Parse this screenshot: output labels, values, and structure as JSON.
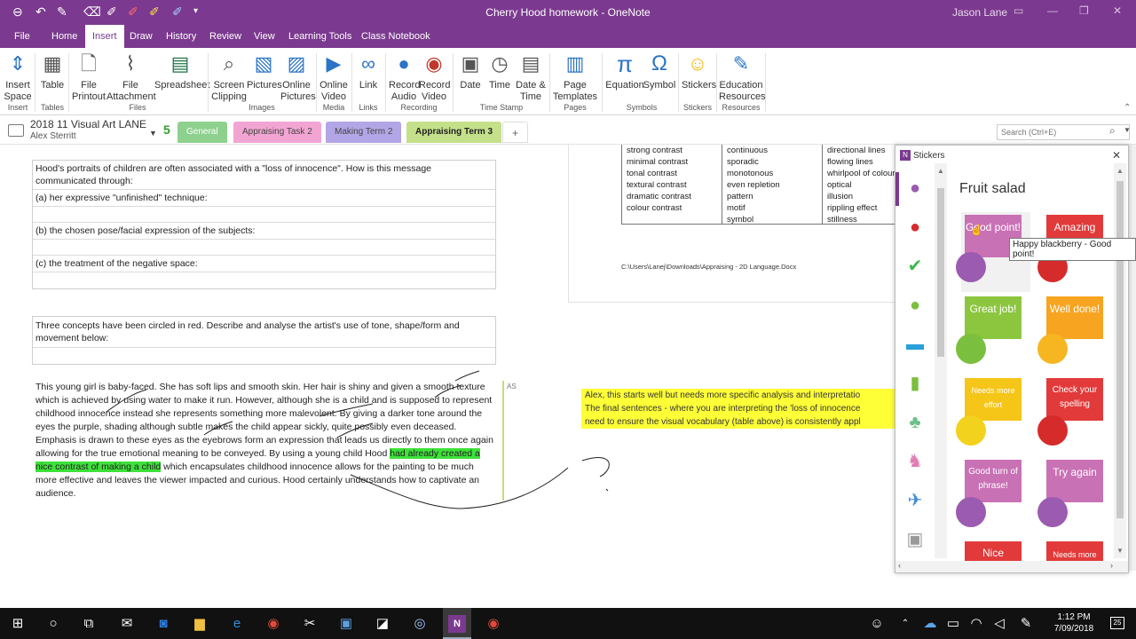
{
  "window": {
    "title": "Cherry Hood homework - OneNote",
    "user": "Jason Lane"
  },
  "menu": [
    "File",
    "Home",
    "Insert",
    "Draw",
    "History",
    "Review",
    "View",
    "Learning Tools",
    "Class Notebook"
  ],
  "ribbon": {
    "buttons": [
      {
        "id": "insert-space",
        "label": "Insert\nSpace",
        "icon": "arrow-up-down-icon"
      },
      {
        "id": "table",
        "label": "Table",
        "icon": "table-icon"
      },
      {
        "id": "file-printout",
        "label": "File\nPrintout",
        "icon": "file-icon"
      },
      {
        "id": "file-attachment",
        "label": "File\nAttachment",
        "icon": "paperclip-icon"
      },
      {
        "id": "spreadsheet",
        "label": "Spreadsheet",
        "icon": "excel-icon"
      },
      {
        "id": "screen-clipping",
        "label": "Screen\nClipping",
        "icon": "camera-icon"
      },
      {
        "id": "pictures",
        "label": "Pictures",
        "icon": "picture-icon"
      },
      {
        "id": "online-pictures",
        "label": "Online\nPictures",
        "icon": "online-picture-icon"
      },
      {
        "id": "online-video",
        "label": "Online\nVideo",
        "icon": "video-icon"
      },
      {
        "id": "link",
        "label": "Link",
        "icon": "link-icon"
      },
      {
        "id": "record-audio",
        "label": "Record\nAudio",
        "icon": "microphone-icon"
      },
      {
        "id": "record-video",
        "label": "Record\nVideo",
        "icon": "camera-record-icon"
      },
      {
        "id": "date",
        "label": "Date",
        "icon": "calendar-icon"
      },
      {
        "id": "time",
        "label": "Time",
        "icon": "clock-icon"
      },
      {
        "id": "date-time",
        "label": "Date &\nTime",
        "icon": "calendar-clock-icon"
      },
      {
        "id": "page-templates",
        "label": "Page\nTemplates",
        "icon": "page-icon"
      },
      {
        "id": "equation",
        "label": "Equation",
        "icon": "pi-icon"
      },
      {
        "id": "symbol",
        "label": "Symbol",
        "icon": "omega-icon"
      },
      {
        "id": "stickers",
        "label": "Stickers",
        "icon": "smiley-icon"
      },
      {
        "id": "education-resources",
        "label": "Education\nResources",
        "icon": "education-icon"
      }
    ],
    "groups": [
      "Insert",
      "Tables",
      "Files",
      "Images",
      "Media",
      "Links",
      "Recording",
      "Time Stamp",
      "Pages",
      "Symbols",
      "Stickers",
      "Resources"
    ]
  },
  "notebook": {
    "name": "2018 11 Visual Art LANE",
    "owner": "Alex Sterritt",
    "tab_count": "5"
  },
  "sections": [
    {
      "label": "General",
      "color": "#8ed18e"
    },
    {
      "label": "Appraising Task 2",
      "color": "#f2a5d3"
    },
    {
      "label": "Making Term 2",
      "color": "#b3a6e6"
    },
    {
      "label": "Appraising Term 3",
      "color": "#c4e08a"
    }
  ],
  "add_section": "+",
  "search_placeholder": "Search (Ctrl+E)",
  "page": {
    "q1": {
      "prompt": "Hood's portraits of children are often associated with a \"loss of innocence\". How is this message communicated through:",
      "a": "(a) her expressive \"unfinished\" technique:",
      "b": "(b) the chosen pose/facial expression of the subjects:",
      "c": "(c) the treatment of the negative space:"
    },
    "q2": {
      "prompt": "Three concepts have been circled in red. Describe and analyse the artist's use of tone, shape/form and movement below:"
    },
    "paragraph_before": "This young girl is baby-faced. She has soft lips and smooth skin. Her hair is shiny and given a smooth texture which is achieved by using water to make it run. However, although she is a child and is supposed to represent childhood innocence instead she represents something more malevolent. By giving a darker tone around the eyes the purple, shading although subtle makes the child appear sickly, quite possibly even deceased. Emphasis is drawn to these eyes as the eyebrows form an expression that leads us directly to them once again allowing for the true emotional meaning to be conveyed. By using a young child Hood ",
    "paragraph_highlight": "had already created a nice contrast of making a child",
    "paragraph_after": " which encapsulates childhood innocence allows for the painting to be much more effective and leaves the viewer impacted and curious. Hood certainly understands how to captivate an audience.",
    "initials": "AS",
    "vocab": {
      "col1": [
        "strong contrast",
        "minimal contrast",
        "tonal contrast",
        "textural contrast",
        "dramatic contrast",
        "colour contrast"
      ],
      "col2": [
        "continuous",
        "sporadic",
        "monotonous",
        "even repletion",
        "pattern",
        "motif",
        "symbol"
      ],
      "col3": [
        "directional lines",
        "flowing lines",
        "whirlpool of colour",
        "optical",
        "illusion",
        "rippling effect",
        "stillness"
      ]
    },
    "doc_path": "C:\\Users\\Lanej\\Downloads\\Appraising - 2D Language.Docx",
    "feedback": [
      "Alex, this starts well but needs more specific analysis and interpretatio",
      "The final sentences - where you are interpreting the 'loss of innocence",
      "need to ensure the visual vocabulary (table above) is consistently appl"
    ]
  },
  "stickers_pane": {
    "title": "Stickers",
    "set_title": "Fruit salad",
    "tooltip": "Happy blackberry - Good point!",
    "stickers": [
      {
        "label": "Good point!",
        "bubble": "#c971b5",
        "face": "#9b5bb0"
      },
      {
        "label": "Amazing",
        "bubble": "#e23a3a",
        "face": "#d62b2b"
      },
      {
        "label": "Great job!",
        "bubble": "#8cc63f",
        "face": "#7bbf3e"
      },
      {
        "label": "Well done!",
        "bubble": "#f7a421",
        "face": "#f5b622"
      },
      {
        "label": "Needs more effort",
        "bubble": "#f5c518",
        "face": "#f2d21c"
      },
      {
        "label": "Check your spelling",
        "bubble": "#e23a3a",
        "face": "#d62b2b"
      },
      {
        "label": "Good turn of phrase!",
        "bubble": "#c971b5",
        "face": "#9b5bb0"
      },
      {
        "label": "Try again",
        "bubble": "#c971b5",
        "face": "#9b5bb0"
      },
      {
        "label": "Nice",
        "bubble": "#e23a3a",
        "face": "#d62b2b"
      },
      {
        "label": "Needs more",
        "bubble": "#e23a3a",
        "face": "#d62b2b"
      }
    ]
  },
  "taskbar": {
    "time": "1:12 PM",
    "date": "7/09/2018",
    "notifications": "25"
  }
}
